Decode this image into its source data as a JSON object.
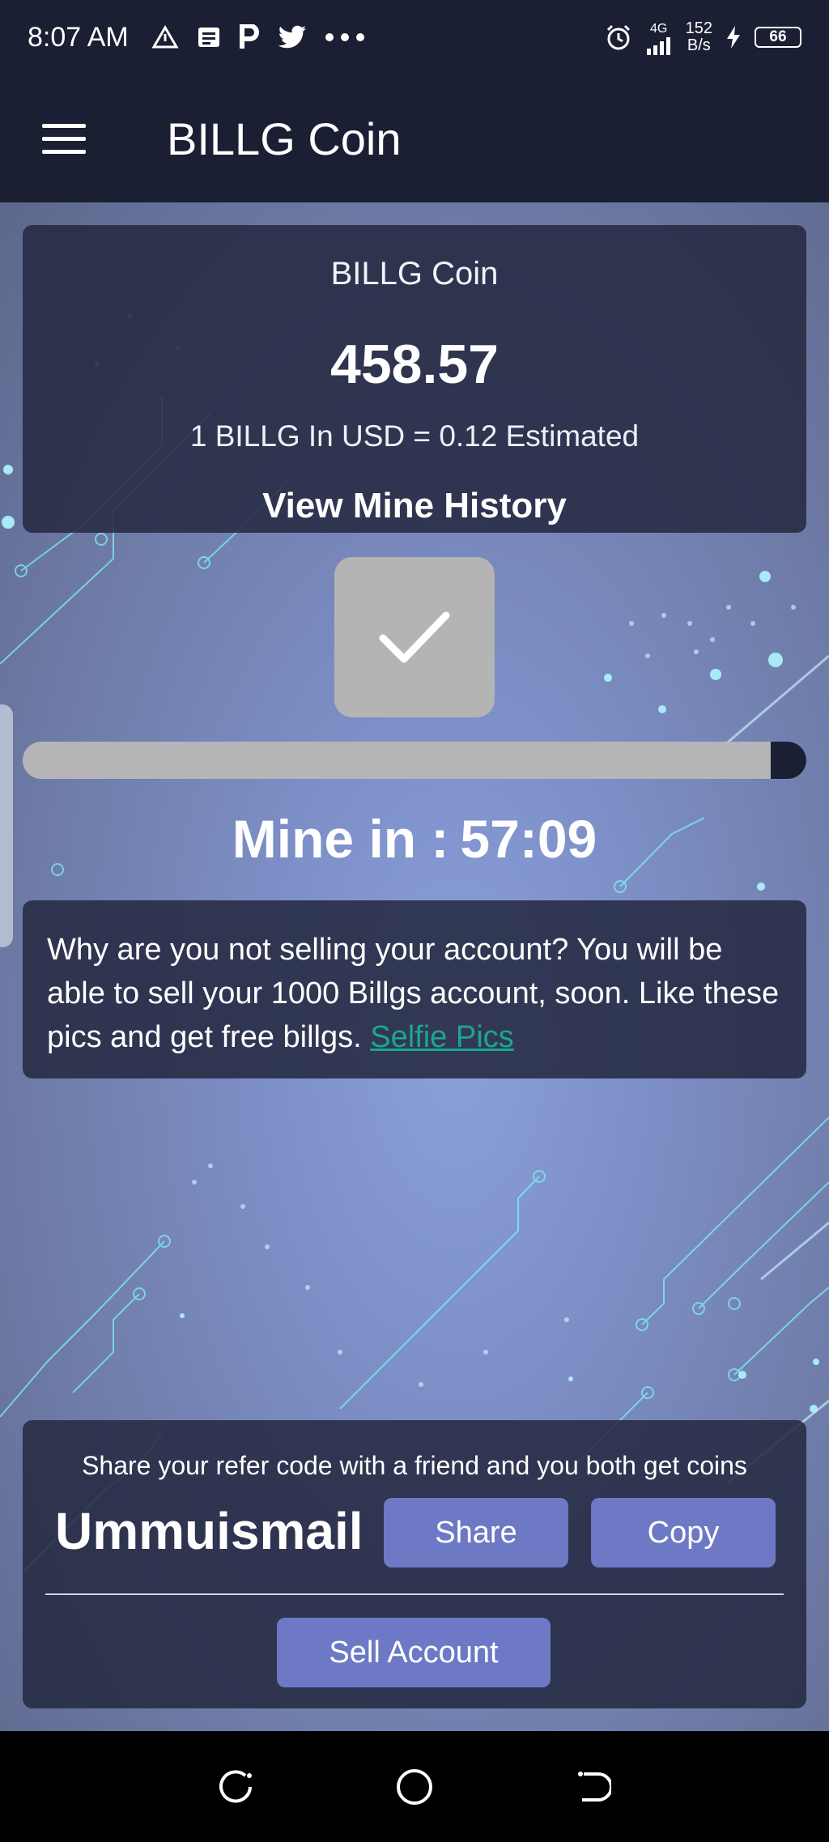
{
  "status_bar": {
    "time": "8:07 AM",
    "network_label": "4G",
    "speed_value": "152",
    "speed_unit": "B/s",
    "battery_level": "66",
    "icons": [
      "warning-icon",
      "news-icon",
      "p-icon",
      "twitter-icon",
      "more-dots-icon",
      "alarm-icon",
      "signal-icon",
      "charging-icon"
    ]
  },
  "app_bar": {
    "title": "BILLG Coin"
  },
  "balance_card": {
    "label": "BILLG Coin",
    "value": "458.57",
    "rate_text": "1 BILLG In USD = 0.12 Estimated",
    "history_link": "View Mine History"
  },
  "mining": {
    "progress_fraction": 0.955,
    "countdown_label": "Mine in :",
    "countdown_value": "57:09"
  },
  "notice": {
    "text": "Why are you not selling your account? You will be able to sell your 1000 Billgs account, soon. Like these pics and get free billgs.",
    "link_text": "Selfie Pics"
  },
  "refer": {
    "text": "Share your refer code with a friend and you both get coins",
    "code": "Ummuismail",
    "share_label": "Share",
    "copy_label": "Copy",
    "sell_label": "Sell Account"
  },
  "colors": {
    "bar": "#1b1f33",
    "button": "#6d79c4",
    "link": "#1aa68e"
  }
}
